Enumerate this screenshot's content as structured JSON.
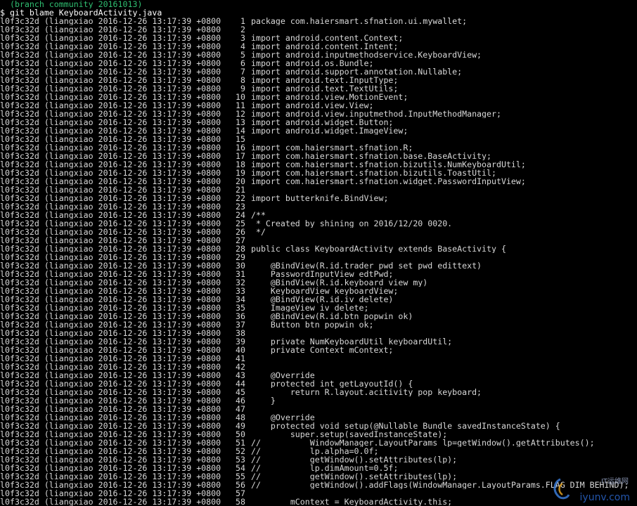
{
  "window": {
    "top_line": "  (branch_community_20161013)",
    "command": "$ git blame KeyboardActivity.java"
  },
  "blame": {
    "hash": "l0f3c32d",
    "author": "liangxiao",
    "timestamp": "2016-12-26 13:17:39 +0800",
    "lines": [
      {
        "n": "1",
        "code": "package com.haiersmart.sfnation.ui.mywallet;"
      },
      {
        "n": "2",
        "code": ""
      },
      {
        "n": "3",
        "code": "import android.content.Context;"
      },
      {
        "n": "4",
        "code": "import android.content.Intent;"
      },
      {
        "n": "5",
        "code": "import android.inputmethodservice.KeyboardView;"
      },
      {
        "n": "6",
        "code": "import android.os.Bundle;"
      },
      {
        "n": "7",
        "code": "import android.support.annotation.Nullable;"
      },
      {
        "n": "8",
        "code": "import android.text.InputType;"
      },
      {
        "n": "9",
        "code": "import android.text.TextUtils;"
      },
      {
        "n": "10",
        "code": "import android.view.MotionEvent;"
      },
      {
        "n": "11",
        "code": "import android.view.View;"
      },
      {
        "n": "12",
        "code": "import android.view.inputmethod.InputMethodManager;"
      },
      {
        "n": "13",
        "code": "import android.widget.Button;"
      },
      {
        "n": "14",
        "code": "import android.widget.ImageView;"
      },
      {
        "n": "15",
        "code": ""
      },
      {
        "n": "16",
        "code": "import com.haiersmart.sfnation.R;"
      },
      {
        "n": "17",
        "code": "import com.haiersmart.sfnation.base.BaseActivity;"
      },
      {
        "n": "18",
        "code": "import com.haiersmart.sfnation.bizutils.NumKeyboardUtil;"
      },
      {
        "n": "19",
        "code": "import com.haiersmart.sfnation.bizutils.ToastUtil;"
      },
      {
        "n": "20",
        "code": "import com.haiersmart.sfnation.widget.PasswordInputView;"
      },
      {
        "n": "21",
        "code": ""
      },
      {
        "n": "22",
        "code": "import butterknife.BindView;"
      },
      {
        "n": "23",
        "code": ""
      },
      {
        "n": "24",
        "code": "/**"
      },
      {
        "n": "25",
        "code": " * Created by shining on 2016/12/20 0020."
      },
      {
        "n": "26",
        "code": " */"
      },
      {
        "n": "27",
        "code": ""
      },
      {
        "n": "28",
        "code": "public class KeyboardActivity extends BaseActivity {"
      },
      {
        "n": "29",
        "code": ""
      },
      {
        "n": "30",
        "code": "    @BindView(R.id.trader_pwd_set_pwd_edittext)"
      },
      {
        "n": "31",
        "code": "    PasswordInputView edtPwd;"
      },
      {
        "n": "32",
        "code": "    @BindView(R.id.keyboard_view_my)"
      },
      {
        "n": "33",
        "code": "    KeyboardView keyboardView;"
      },
      {
        "n": "34",
        "code": "    @BindView(R.id.iv_delete)"
      },
      {
        "n": "35",
        "code": "    ImageView iv_delete;"
      },
      {
        "n": "36",
        "code": "    @BindView(R.id.btn_popwin_ok)"
      },
      {
        "n": "37",
        "code": "    Button btn_popwin_ok;"
      },
      {
        "n": "38",
        "code": ""
      },
      {
        "n": "39",
        "code": "    private NumKeyboardUtil keyboardUtil;"
      },
      {
        "n": "40",
        "code": "    private Context mContext;"
      },
      {
        "n": "41",
        "code": ""
      },
      {
        "n": "42",
        "code": ""
      },
      {
        "n": "43",
        "code": "    @Override"
      },
      {
        "n": "44",
        "code": "    protected int getLayoutId() {"
      },
      {
        "n": "45",
        "code": "        return R.layout.acitivity_pop_keyboard;"
      },
      {
        "n": "46",
        "code": "    }"
      },
      {
        "n": "47",
        "code": ""
      },
      {
        "n": "48",
        "code": "    @Override"
      },
      {
        "n": "49",
        "code": "    protected void setup(@Nullable Bundle savedInstanceState) {"
      },
      {
        "n": "50",
        "code": "        super.setup(savedInstanceState);"
      },
      {
        "n": "51",
        "code": "//          WindowManager.LayoutParams lp=getWindow().getAttributes();"
      },
      {
        "n": "52",
        "code": "//          lp.alpha=0.0f;"
      },
      {
        "n": "53",
        "code": "//          getWindow().setAttributes(lp);"
      },
      {
        "n": "54",
        "code": "//          lp.dimAmount=0.5f;"
      },
      {
        "n": "55",
        "code": "//          getWindow().setAttributes(lp);"
      },
      {
        "n": "56",
        "code": "//          getWindow().addFlags(WindowManager.LayoutParams.FLAG_DIM_BEHIND);"
      },
      {
        "n": "57",
        "code": ""
      },
      {
        "n": "58",
        "code": "        mContext = KeyboardActivity.this;"
      }
    ]
  },
  "watermark": {
    "brand": "iyunv.com",
    "sub": "IT运维网"
  },
  "colors": {
    "background": "#000000",
    "foreground": "#d8d8d8",
    "branch_text": "#2fbf71",
    "watermark_blue": "#2a64c8"
  }
}
